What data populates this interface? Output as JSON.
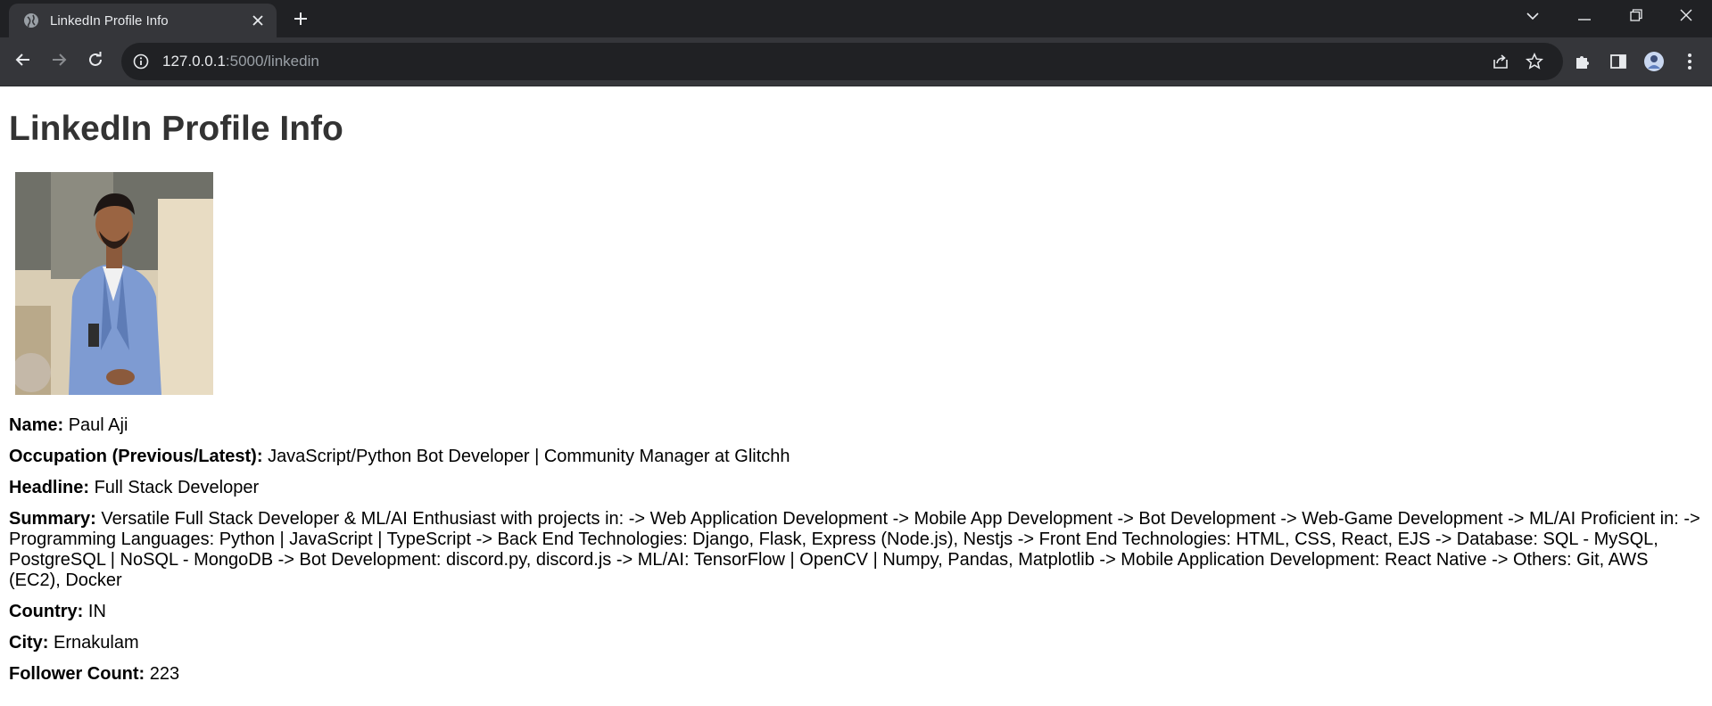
{
  "browser": {
    "tab_title": "LinkedIn Profile Info",
    "url_host": "127.0.0.1",
    "url_path": ":5000/linkedin"
  },
  "page": {
    "heading": "LinkedIn Profile Info",
    "photo_alt": "Profile picture",
    "fields": {
      "name": {
        "label": "Name:",
        "value": "Paul Aji"
      },
      "occupation": {
        "label": "Occupation (Previous/Latest):",
        "value": "JavaScript/Python Bot Developer | Community Manager at Glitchh"
      },
      "headline": {
        "label": "Headline:",
        "value": "Full Stack Developer"
      },
      "summary": {
        "label": "Summary:",
        "value": "Versatile Full Stack Developer & ML/AI Enthusiast with projects in: -> Web Application Development -> Mobile App Development -> Bot Development -> Web-Game Development -> ML/AI Proficient in: -> Programming Languages: Python | JavaScript | TypeScript -> Back End Technologies: Django, Flask, Express (Node.js), Nestjs -> Front End Technologies: HTML, CSS, React, EJS -> Database: SQL - MySQL, PostgreSQL | NoSQL - MongoDB -> Bot Development: discord.py, discord.js -> ML/AI: TensorFlow | OpenCV | Numpy, Pandas, Matplotlib -> Mobile Application Development: React Native -> Others: Git, AWS (EC2), Docker"
      },
      "country": {
        "label": "Country:",
        "value": "IN"
      },
      "city": {
        "label": "City:",
        "value": "Ernakulam"
      },
      "follower_count": {
        "label": "Follower Count:",
        "value": "223"
      }
    }
  },
  "icons": {
    "favicon": "globe-icon",
    "tab_close": "close-icon",
    "new_tab": "plus-icon",
    "tab_search": "chevron-down-icon",
    "minimize": "minimize-icon",
    "restore": "restore-icon",
    "close_window": "close-icon",
    "back": "back-arrow-icon",
    "forward": "forward-arrow-icon",
    "reload": "reload-icon",
    "site_info": "info-icon",
    "share": "share-icon",
    "bookmark": "star-icon",
    "extensions": "puzzle-icon",
    "side_panel": "side-panel-icon",
    "profile": "avatar-icon",
    "menu": "kebab-menu-icon"
  },
  "colors": {
    "tabbar_bg": "#202124",
    "toolbar_bg": "#35363a",
    "omnibox_bg": "#202124",
    "heading_text": "#333333"
  }
}
